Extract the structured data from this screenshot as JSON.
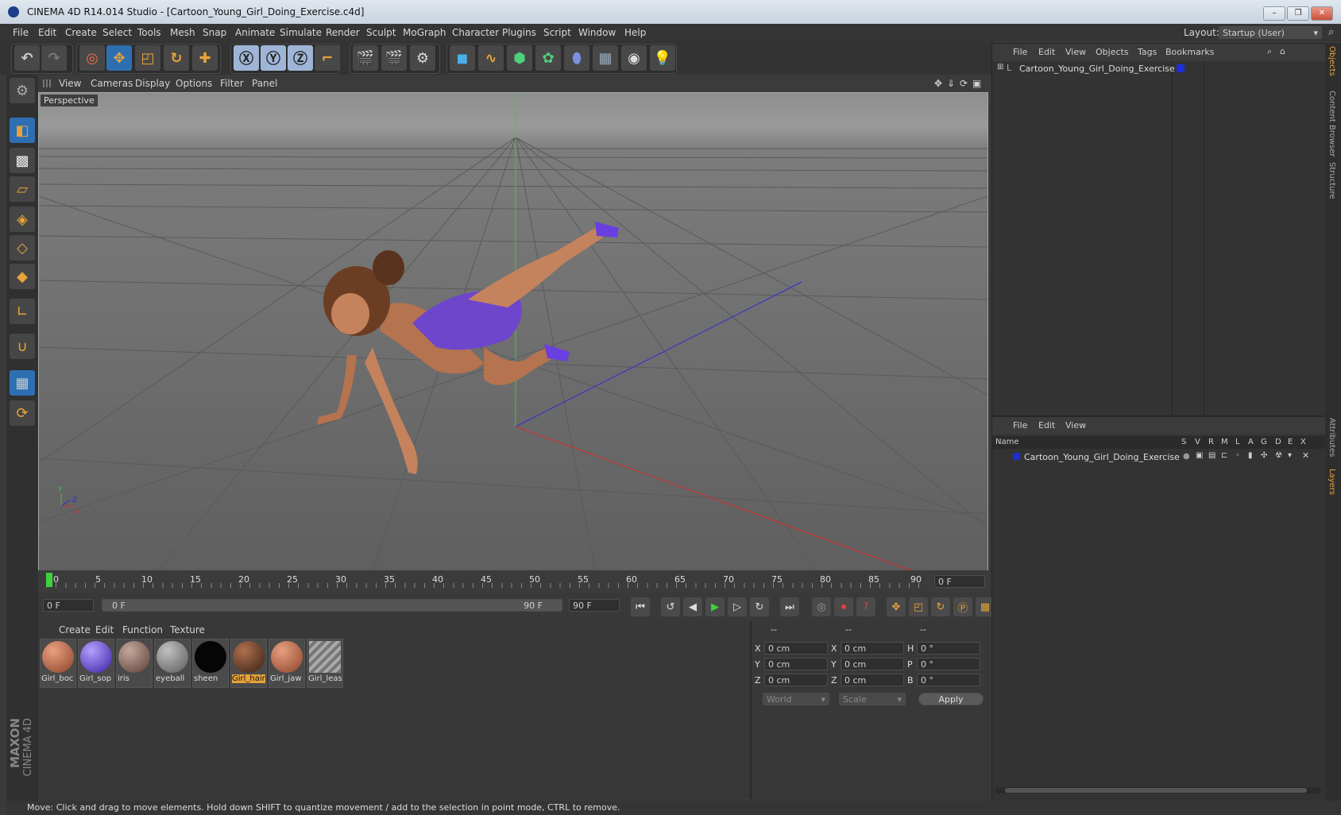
{
  "window": {
    "title": "CINEMA 4D R14.014 Studio - [Cartoon_Young_Girl_Doing_Exercise.c4d]"
  },
  "menubar": [
    "File",
    "Edit",
    "Create",
    "Select",
    "Tools",
    "Mesh",
    "Snap",
    "Animate",
    "Simulate",
    "Render",
    "Sculpt",
    "MoGraph",
    "Character",
    "Plugins",
    "Script",
    "Window",
    "Help"
  ],
  "layout": {
    "label": "Layout:",
    "value": "Startup (User)"
  },
  "viewport": {
    "menu": [
      "View",
      "Cameras",
      "Display",
      "Options",
      "Filter",
      "Panel"
    ],
    "label": "Perspective",
    "axis_labels": {
      "y": "Y",
      "z": "Z",
      "x": "X"
    }
  },
  "timeline": {
    "ticks": [
      "0",
      "5",
      "10",
      "15",
      "20",
      "25",
      "30",
      "35",
      "40",
      "45",
      "50",
      "55",
      "60",
      "65",
      "70",
      "75",
      "80",
      "85",
      "90"
    ],
    "current_frame": "0 F",
    "start_field": "0 F",
    "range_start": "0 F",
    "range_end": "90 F",
    "end_field": "90 F"
  },
  "materials": {
    "menu": [
      "Create",
      "Edit",
      "Function",
      "Texture"
    ],
    "items": [
      {
        "label": "Girl_boc",
        "color": "#b56b4d"
      },
      {
        "label": "Girl_sop",
        "color": "#5a3fc0"
      },
      {
        "label": "iris",
        "color": "#8b6c62"
      },
      {
        "label": "eyeball",
        "color": "#9a9a9a"
      },
      {
        "label": "sheen",
        "color": "#050505"
      },
      {
        "label": "Girl_hair",
        "color": "#7a4a2e"
      },
      {
        "label": "Girl_jaw",
        "color": "#b56b4d"
      },
      {
        "label": "Girl_leas",
        "color": "#8f8f8f"
      }
    ]
  },
  "coords": {
    "headers": [
      "--",
      "--",
      "--"
    ],
    "rows": [
      {
        "a": "X",
        "av": "0 cm",
        "b": "X",
        "bv": "0 cm",
        "c": "H",
        "cv": "0 °"
      },
      {
        "a": "Y",
        "av": "0 cm",
        "b": "Y",
        "bv": "0 cm",
        "c": "P",
        "cv": "0 °"
      },
      {
        "a": "Z",
        "av": "0 cm",
        "b": "Z",
        "bv": "0 cm",
        "c": "B",
        "cv": "0 °"
      }
    ],
    "world": "World",
    "scale": "Scale",
    "apply": "Apply"
  },
  "objects": {
    "menu": [
      "File",
      "Edit",
      "View",
      "Objects",
      "Tags",
      "Bookmarks"
    ],
    "item": "Cartoon_Young_Girl_Doing_Exercise"
  },
  "layers": {
    "menu": [
      "File",
      "Edit",
      "View"
    ],
    "col_name": "Name",
    "cols": [
      "S",
      "V",
      "R",
      "M",
      "L",
      "A",
      "G",
      "D",
      "E",
      "X"
    ],
    "item": "Cartoon_Young_Girl_Doing_Exercise"
  },
  "sidetabs": [
    "Objects",
    "Content Browser",
    "Structure",
    "Attributes",
    "Layers"
  ],
  "brand": {
    "maxon": "MAXON",
    "c4d": "CINEMA 4D"
  },
  "status": "Move: Click and drag to move elements. Hold down SHIFT to quantize movement / add to the selection in point mode, CTRL to remove.",
  "colors": {
    "accent": "#e8a33a",
    "selection": "#2e6fb2",
    "layer_color": "#1a2fd6"
  }
}
